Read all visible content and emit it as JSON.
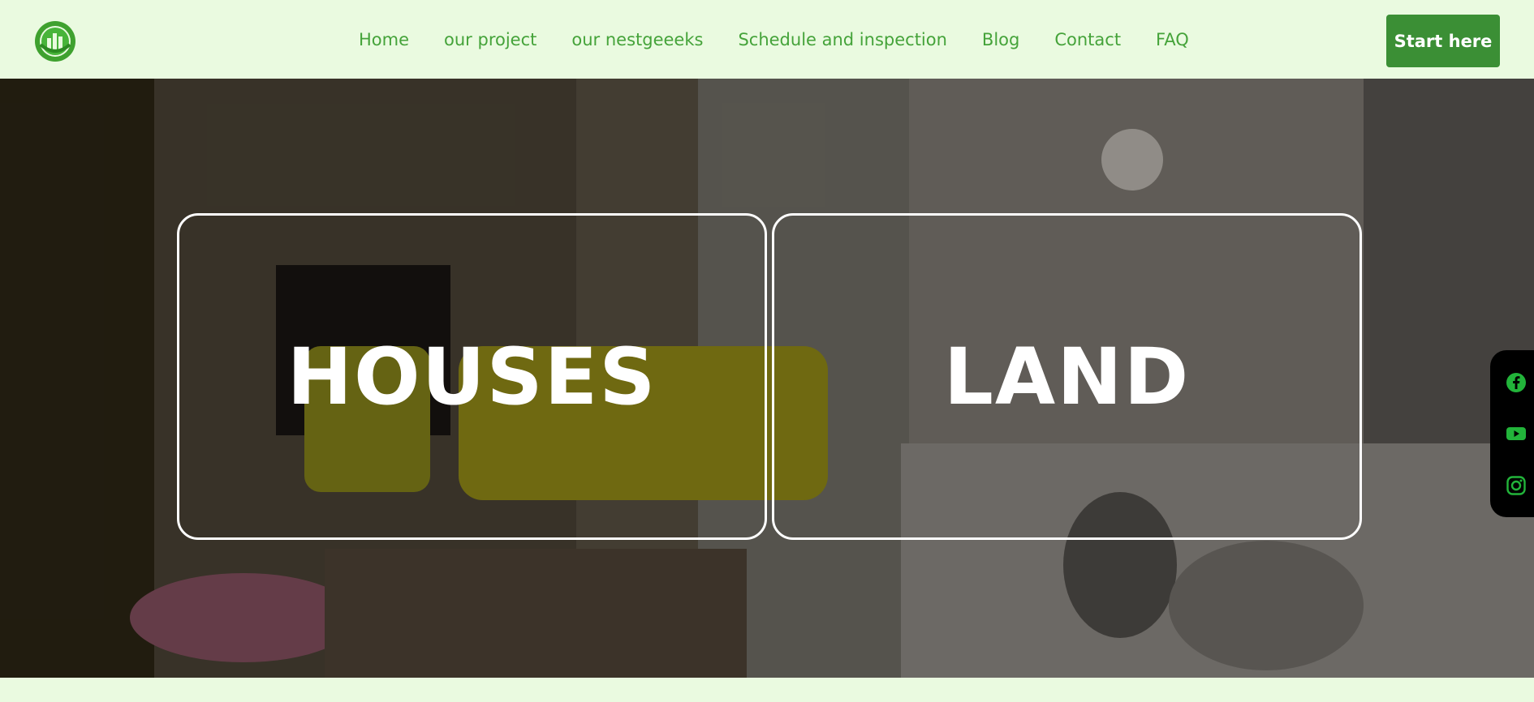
{
  "header": {
    "logo_icon": "building-chart-logo",
    "nav": [
      {
        "label": "Home"
      },
      {
        "label": "our project"
      },
      {
        "label": "our nestgeeeks"
      },
      {
        "label": "Schedule and inspection"
      },
      {
        "label": "Blog"
      },
      {
        "label": "Contact"
      },
      {
        "label": "FAQ"
      }
    ],
    "cta_label": "Start here"
  },
  "hero": {
    "categories": [
      {
        "label": "HOUSES"
      },
      {
        "label": "LAND"
      }
    ]
  },
  "social": {
    "icons": [
      "facebook-icon",
      "youtube-icon",
      "instagram-icon"
    ]
  },
  "colors": {
    "background": "#eafae0",
    "nav_text": "#45a33a",
    "cta_bg": "#3b8f35",
    "social_icon": "#22b43a"
  }
}
